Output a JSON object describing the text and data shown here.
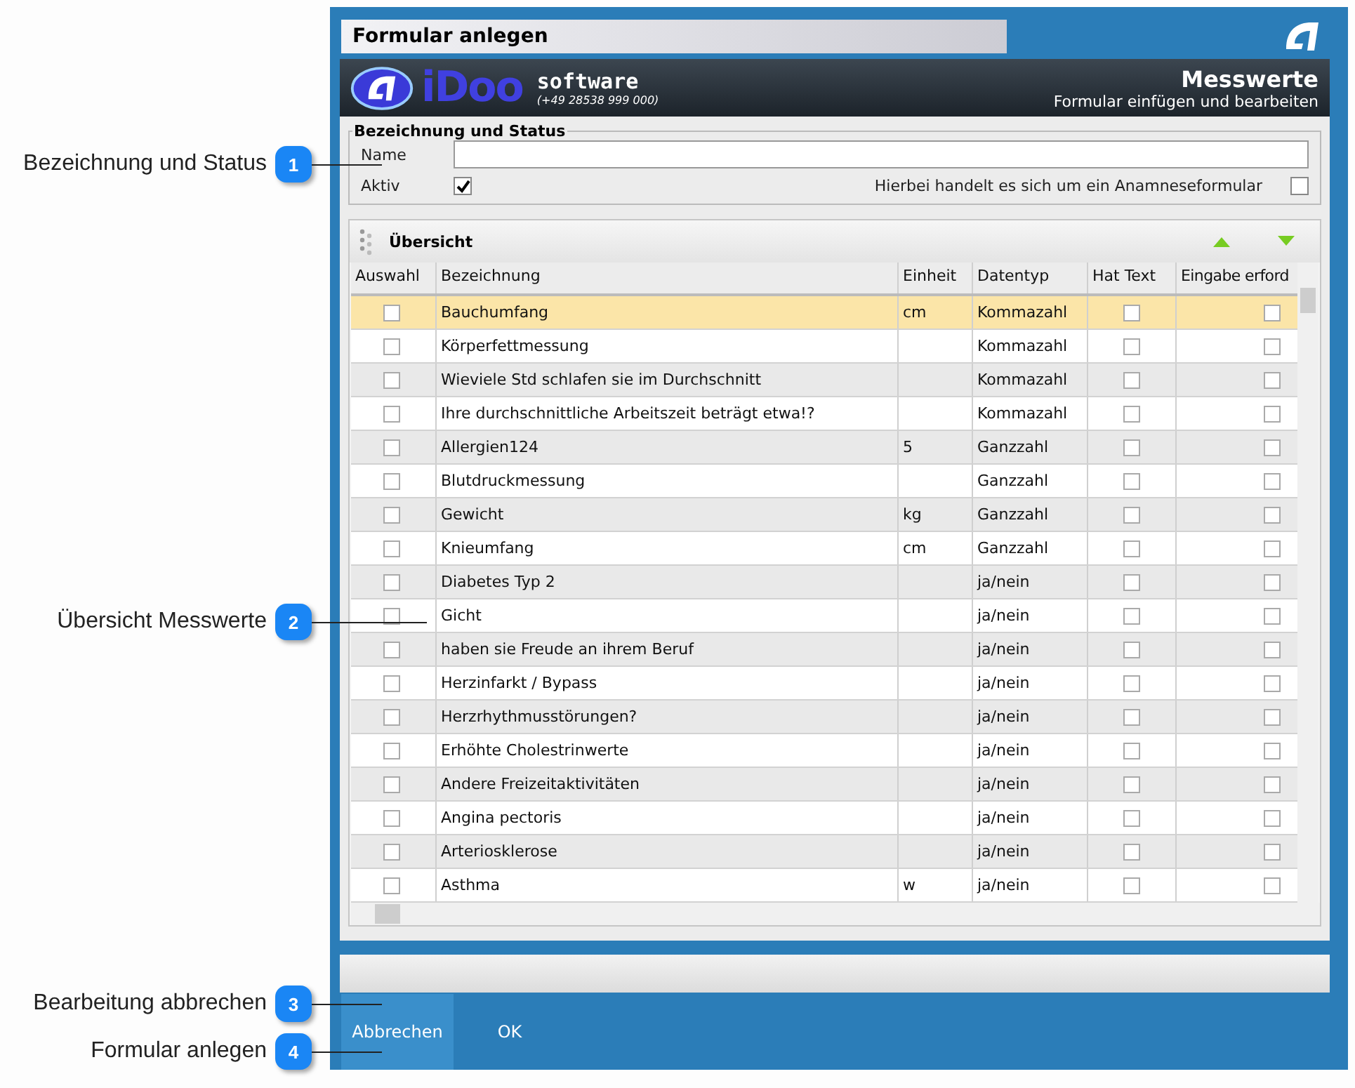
{
  "callouts": [
    {
      "number": "1",
      "label": "Bezeichnung und Status"
    },
    {
      "number": "2",
      "label": "Übersicht Messwerte"
    },
    {
      "number": "3",
      "label": "Bearbeitung abbrechen"
    },
    {
      "number": "4",
      "label": "Formular anlegen"
    }
  ],
  "window": {
    "title": "Formular anlegen"
  },
  "header": {
    "brand": "iDoo",
    "brand_word": "software",
    "phone": "(+49 28538 999 000)",
    "title": "Messwerte",
    "subtitle": "Formular einfügen und bearbeiten"
  },
  "status_group": {
    "legend": "Bezeichnung und Status",
    "name_label": "Name",
    "active_label": "Aktiv",
    "active_checked": true,
    "anamnese_label": "Hierbei handelt es sich um ein Anamneseformular",
    "anamnese_checked": false
  },
  "overview": {
    "title": "Übersicht",
    "columns": [
      "Auswahl",
      "Bezeichnung",
      "Einheit",
      "Datentyp",
      "Hat Text",
      "Eingabe erford"
    ],
    "rows": [
      {
        "selected": true,
        "chosen": false,
        "name": "Bauchumfang",
        "unit": "cm",
        "type": "Kommazahl",
        "has_text": false,
        "required": false
      },
      {
        "selected": false,
        "chosen": false,
        "name": "Körperfettmessung",
        "unit": "",
        "type": "Kommazahl",
        "has_text": false,
        "required": false
      },
      {
        "selected": false,
        "chosen": false,
        "name": "Wieviele Std schlafen sie im Durchschnitt",
        "unit": "",
        "type": "Kommazahl",
        "has_text": false,
        "required": false
      },
      {
        "selected": false,
        "chosen": false,
        "name": "Ihre durchschnittliche Arbeitszeit beträgt etwa!?",
        "unit": "",
        "type": "Kommazahl",
        "has_text": false,
        "required": false
      },
      {
        "selected": false,
        "chosen": false,
        "name": "Allergien124",
        "unit": "5",
        "type": "Ganzzahl",
        "has_text": false,
        "required": false
      },
      {
        "selected": false,
        "chosen": false,
        "name": "Blutdruckmessung",
        "unit": "",
        "type": "Ganzzahl",
        "has_text": false,
        "required": false
      },
      {
        "selected": false,
        "chosen": false,
        "name": "Gewicht",
        "unit": "kg",
        "type": "Ganzzahl",
        "has_text": false,
        "required": false
      },
      {
        "selected": false,
        "chosen": false,
        "name": "Knieumfang",
        "unit": "cm",
        "type": "Ganzzahl",
        "has_text": false,
        "required": false
      },
      {
        "selected": false,
        "chosen": false,
        "name": "Diabetes Typ 2",
        "unit": "",
        "type": "ja/nein",
        "has_text": false,
        "required": false
      },
      {
        "selected": false,
        "chosen": false,
        "name": "Gicht",
        "unit": "",
        "type": "ja/nein",
        "has_text": false,
        "required": false
      },
      {
        "selected": false,
        "chosen": false,
        "name": "haben sie Freude an ihrem Beruf",
        "unit": "",
        "type": "ja/nein",
        "has_text": false,
        "required": false
      },
      {
        "selected": false,
        "chosen": false,
        "name": "Herzinfarkt / Bypass",
        "unit": "",
        "type": "ja/nein",
        "has_text": false,
        "required": false
      },
      {
        "selected": false,
        "chosen": false,
        "name": "Herzrhythmusstörungen?",
        "unit": "",
        "type": "ja/nein",
        "has_text": false,
        "required": false
      },
      {
        "selected": false,
        "chosen": false,
        "name": "Erhöhte Cholestrinwerte",
        "unit": "",
        "type": "ja/nein",
        "has_text": false,
        "required": false
      },
      {
        "selected": false,
        "chosen": false,
        "name": "Andere Freizeitaktivitäten",
        "unit": "",
        "type": "ja/nein",
        "has_text": false,
        "required": false
      },
      {
        "selected": false,
        "chosen": false,
        "name": "Angina pectoris",
        "unit": "",
        "type": "ja/nein",
        "has_text": false,
        "required": false
      },
      {
        "selected": false,
        "chosen": false,
        "name": "Arteriosklerose",
        "unit": "",
        "type": "ja/nein",
        "has_text": false,
        "required": false
      },
      {
        "selected": false,
        "chosen": false,
        "name": "Asthma",
        "unit": "w",
        "type": "ja/nein",
        "has_text": false,
        "required": false
      }
    ]
  },
  "buttons": [
    "Abbrechen",
    "OK"
  ]
}
